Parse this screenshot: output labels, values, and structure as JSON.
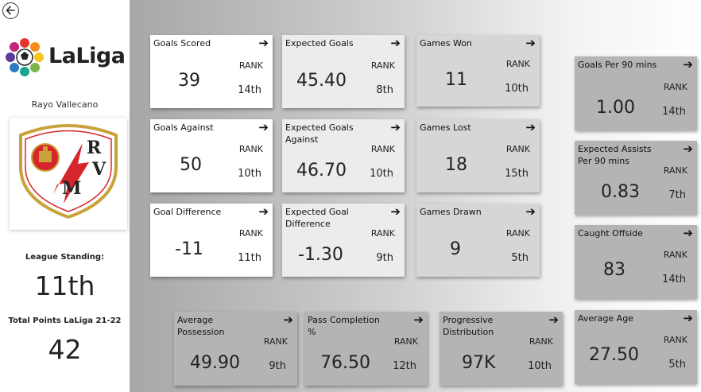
{
  "sidebar": {
    "logo_text": "LaLiga",
    "team_name": "Rayo Vallecano",
    "league_standing_label": "League Standing:",
    "league_standing_value": "11th",
    "total_points_label": "Total Points LaLiga 21-22",
    "total_points_value": "42"
  },
  "rank_label": "RANK",
  "cards": {
    "goals_scored": {
      "title": "Goals Scored",
      "value": "39",
      "rank": "14th"
    },
    "expected_goals": {
      "title": "Expected Goals",
      "value": "45.40",
      "rank": "8th"
    },
    "games_won": {
      "title": "Games Won",
      "value": "11",
      "rank": "10th"
    },
    "goals_per_90": {
      "title": "Goals Per 90 mins",
      "value": "1.00",
      "rank": "14th"
    },
    "goals_against": {
      "title": "Goals Against",
      "value": "50",
      "rank": "10th"
    },
    "expected_goals_against": {
      "title": "Expected Goals Against",
      "value": "46.70",
      "rank": "10th"
    },
    "games_lost": {
      "title": "Games Lost",
      "value": "18",
      "rank": "15th"
    },
    "expected_assists_per_90": {
      "title": "Expected Assists Per 90 mins",
      "value": "0.83",
      "rank": "7th"
    },
    "goal_difference": {
      "title": "Goal Difference",
      "value": "-11",
      "rank": "11th"
    },
    "expected_goal_difference": {
      "title": "Expected Goal Difference",
      "value": "-1.30",
      "rank": "9th"
    },
    "games_drawn": {
      "title": "Games Drawn",
      "value": "9",
      "rank": "5th"
    },
    "caught_offside": {
      "title": "Caught Offside",
      "value": "83",
      "rank": "14th"
    },
    "average_possession": {
      "title": "Average Possession",
      "value": "49.90",
      "rank": "9th"
    },
    "pass_completion": {
      "title": "Pass Completion %",
      "value": "76.50",
      "rank": "12th"
    },
    "progressive_distribution": {
      "title": "Progressive Distribution",
      "value": "97K",
      "rank": "10th"
    },
    "average_age": {
      "title": "Average Age",
      "value": "27.50",
      "rank": "5th"
    }
  },
  "colors": {
    "card_white": "#ffffff",
    "card_light": "#ececec",
    "card_mid": "#d6d6d6",
    "card_dark": "#b4b4b4",
    "crest_red": "#d7262b",
    "crest_gold": "#c9a23a"
  },
  "icons": [
    "back-arrow-icon",
    "laliga-logo-icon",
    "rayo-vallecano-crest-icon",
    "arrow-right-icon"
  ]
}
